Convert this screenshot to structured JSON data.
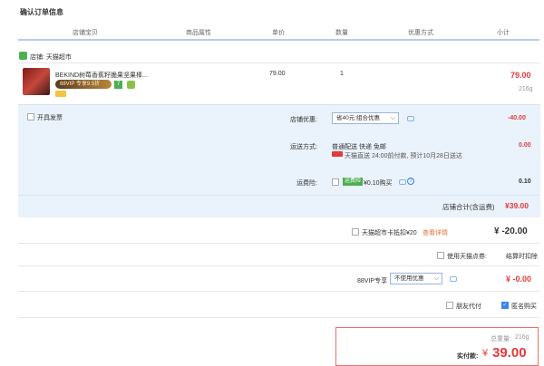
{
  "page": {
    "title": "确认订单信息"
  },
  "columns": [
    "店铺宝贝",
    "商品属性",
    "单价",
    "数量",
    "优惠方式",
    "小计"
  ],
  "shop": {
    "label": "店铺: 天猫超市"
  },
  "item": {
    "name": "BEKIND树莓香蕉籽脆果坚果棒...",
    "vip_badge": "88VIP 专享9.5折",
    "badge_num": "7",
    "price": "79.00",
    "quantity": "1",
    "subtotal": "79.00",
    "weight": "216g"
  },
  "invoice": {
    "label": "开具发票"
  },
  "shop_discount": {
    "label": "店铺优惠:",
    "value": "省40元:组合优惠",
    "amount": "-40.00"
  },
  "shipping": {
    "label": "运送方式:",
    "method": "普通配送 快递 免邮",
    "note": "天猫直送  24:00前付款, 预计10月28日送达",
    "amount": "0.00"
  },
  "insurance": {
    "label": "运费险:",
    "tag": "运费险",
    "text": "¥0.10购买",
    "amount": "0.10"
  },
  "shop_total": {
    "label": "店铺合计(含运费)",
    "value": "¥39.00"
  },
  "card_deduct": {
    "label": "天猫超市卡抵扣¥20",
    "link": "查看详情",
    "amount": "¥ -20.00"
  },
  "tmall_points": {
    "label": "使用天猫点券:",
    "value": "结算时扣除"
  },
  "vip88": {
    "label": "88VIP专享",
    "value": "不使用优惠",
    "amount": "¥ -0.00"
  },
  "options": {
    "friend_pay": "朋友代付",
    "anonymous": "匿名购买"
  },
  "summary": {
    "weight_label": "总重量:",
    "weight": "216g",
    "pay_label": "实付款:",
    "currency": "¥",
    "amount": "39.00"
  },
  "colors": {
    "accent": "#e4393c",
    "panel": "#eaf2fb",
    "link": "#3c82f0"
  }
}
